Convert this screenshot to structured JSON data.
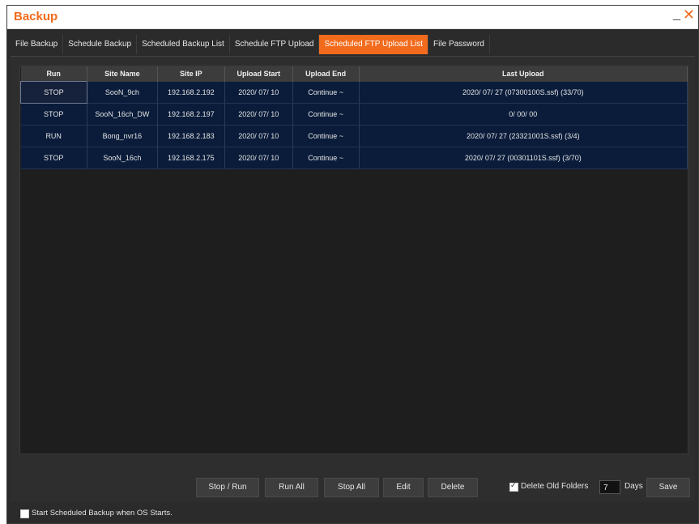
{
  "window": {
    "title": "Backup",
    "minimize": "_",
    "close": "✕"
  },
  "tabs": [
    {
      "label": "File Backup",
      "active": false
    },
    {
      "label": "Schedule Backup",
      "active": false
    },
    {
      "label": "Scheduled Backup List",
      "active": false
    },
    {
      "label": "Schedule FTP Upload",
      "active": false
    },
    {
      "label": "Scheduled FTP Upload List",
      "active": true
    },
    {
      "label": "File Password",
      "active": false
    }
  ],
  "table": {
    "columns": [
      "Run",
      "Site Name",
      "Site IP",
      "Upload Start",
      "Upload End",
      "Last Upload"
    ],
    "rows": [
      [
        "STOP",
        "SooN_9ch",
        "192.168.2.192",
        "2020/ 07/ 10",
        "Continue ~",
        "2020/ 07/ 27 (07300100S.ssf) (33/70)"
      ],
      [
        "STOP",
        "SooN_16ch_DW",
        "192.168.2.197",
        "2020/ 07/ 10",
        "Continue ~",
        "0/ 00/ 00"
      ],
      [
        "RUN",
        "Bong_nvr16",
        "192.168.2.183",
        "2020/ 07/ 10",
        "Continue ~",
        "2020/ 07/ 27 (23321001S.ssf) (3/4)"
      ],
      [
        "STOP",
        "SooN_16ch",
        "192.168.2.175",
        "2020/ 07/ 10",
        "Continue ~",
        "2020/ 07/ 27 (00301101S.ssf) (3/70)"
      ]
    ]
  },
  "buttons": {
    "stop_run": "Stop / Run",
    "run_all": "Run All",
    "stop_all": "Stop All",
    "edit": "Edit",
    "delete": "Delete",
    "save": "Save"
  },
  "options": {
    "delete_old_folders": "Delete Old Folders",
    "days_value": "7",
    "days_label": "Days",
    "start_on_os": "Start Scheduled Backup when OS Starts."
  },
  "colors": {
    "accent": "#f26b1d",
    "row_bg": "#0a1c3a",
    "panel_bg": "#2e2e2e"
  }
}
